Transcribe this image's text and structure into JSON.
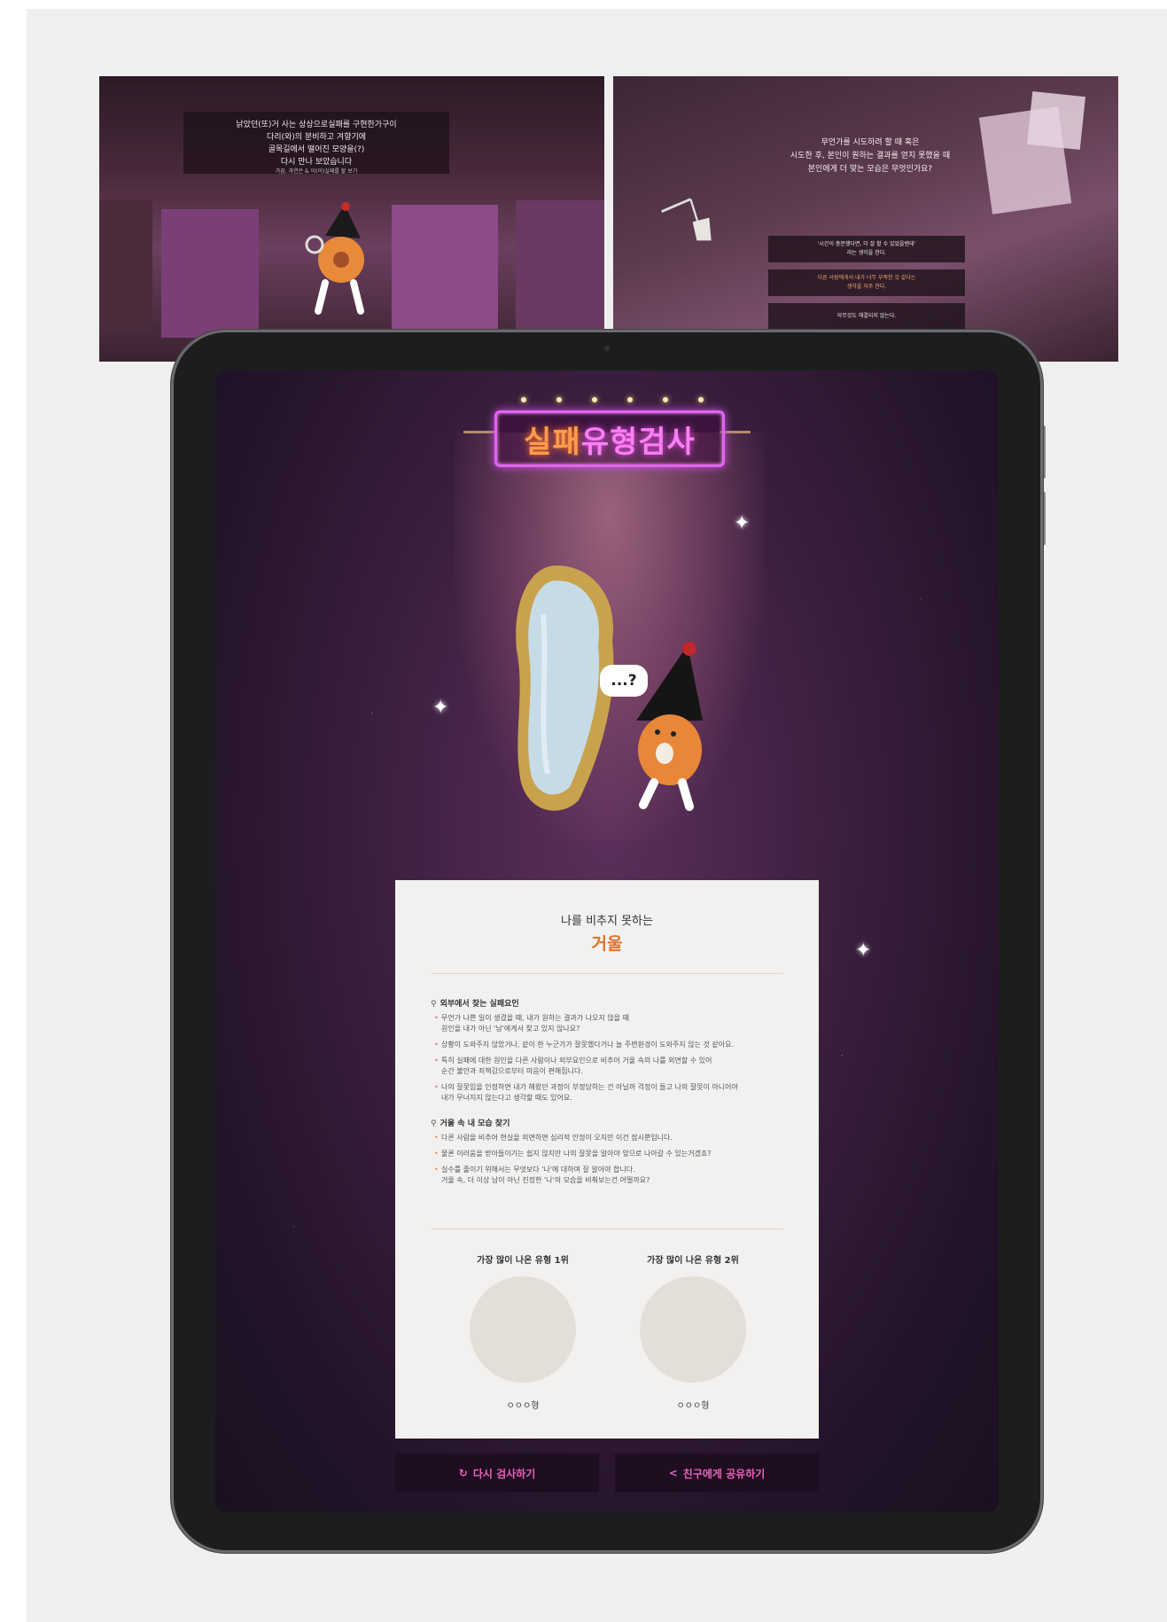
{
  "thumb1": {
    "banner_text": "낡았던(또)거 사는 상상으로실패를 구현한가구이\n다리(와)의 분비하고 겨향기에\n골목길에서 떨어진 모양을(?)\n다시 만나 보았습니다",
    "banner_sub": "가끔, 과연은 & 이(이)실패를 할 보기"
  },
  "thumb2": {
    "question": "무언가를 시도하려 할 때 혹은\n시도한 후, 본인이 원하는 결과를 얻지 못했을 때\n본인에게 더 맞는 모습은 무엇인가요?",
    "options": [
      "'시간이 충분했다면, 더 잘 할 수 있었을텐데'\n라는 생각을 한다.",
      "다른 사람에게서 내가 너무 부족한 것 같다는\n생각을 자주 한다.",
      "아무것도 해결되지 않는다."
    ]
  },
  "screen": {
    "sign": {
      "part1": "실패",
      "part2": "유형검사"
    },
    "bubble": "...?",
    "result": {
      "pre_title": "나를 비추지 못하는",
      "title": "거울",
      "section1": {
        "heading": "외부에서 찾는 실패요인",
        "bullets": [
          "무언가 나쁜 일이 생겼을 때, 내가 원하는 결과가 나오지 않을 때\n원인을 내가 아닌 '남'에게서 찾고 있지 않나요?",
          "상황이 도와주지 않았거나, 같이 한 누군가가 잘못했다거나 늘 주변환경이 도와주지 않는 것 같아요.",
          "특히 실패에 대한 원인을 다른 사람이나 외부요인으로 비추어 거울 속의 나를 외면할 수 있어\n순간 불안과 죄책감으로부터 마음이 편해집니다.",
          "나의 잘못임을 인정하면 내가 해왔던 과정이 부정당하는 건 아닐까 걱정이 들고 나의 잘못이 아니어야\n내가 무너지지 않는다고 생각할 때도 있어요."
        ]
      },
      "section2": {
        "heading": "거울 속 내 모습 찾기",
        "bullets": [
          "다른 사람을 비추어 현실을 외면하면 심리적 안정이 오지만 이건 잠시뿐입니다.",
          "물론 이러움을 받아들이기는 쉽지 않지만 나의 잘못을 알아야 앞으로 나아갈 수 있는거겠죠?",
          "실수를 줄이기 위해서는 무엇보다 '나'에 대하여 잘 알아야 합니다.\n거울 속, 더 이상 남이 아닌 진정한 '나'의 모습을 비춰보는건 어떨까요?"
        ]
      },
      "ranks": [
        {
          "label": "가장 많이 나온 유형 1위",
          "name": "ㅇㅇㅇ형"
        },
        {
          "label": "가장 많이 나온 유형 2위",
          "name": "ㅇㅇㅇ형"
        }
      ]
    },
    "buttons": {
      "retry": "다시 검사하기",
      "share": "친구에게 공유하기"
    }
  },
  "colors": {
    "accent_orange": "#e0722c",
    "accent_pink": "#ea61b8",
    "neon_purple": "#e065f0"
  }
}
